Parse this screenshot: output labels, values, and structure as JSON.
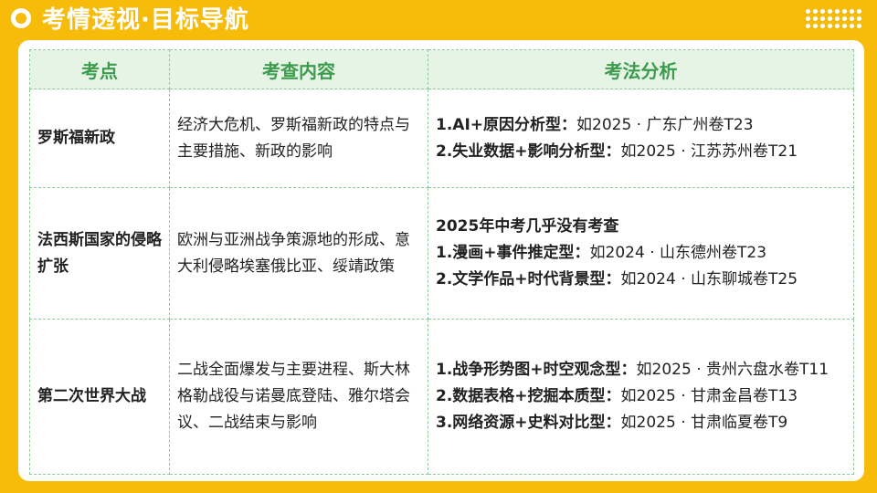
{
  "title": "考情透视·目标导航",
  "colors": {
    "background": "#F7BC0A",
    "header_fill": "#E6F4E6",
    "header_text": "#3C9B4C",
    "border": "#8FC89A"
  },
  "table": {
    "headers": [
      "考点",
      "考查内容",
      "考法分析"
    ],
    "rows": [
      {
        "point": "罗斯福新政",
        "content": "经济大危机、罗斯福新政的特点与主要措施、新政的影响",
        "analysis": [
          {
            "bold": "1.AI+原因分析型：",
            "text": "如2025 · 广东广州卷T23"
          },
          {
            "bold": "2.失业数据+影响分析型：",
            "text": "如2025 · 江苏苏州卷T21"
          }
        ]
      },
      {
        "point": "法西斯国家的侵略扩张",
        "content": "欧洲与亚洲战争策源地的形成、意大利侵略埃塞俄比亚、绥靖政策",
        "analysis": [
          {
            "bold": "2025年中考几乎没有考查",
            "text": ""
          },
          {
            "bold": "1.漫画+事件推定型：",
            "text": "如2024 · 山东德州卷T23"
          },
          {
            "bold": "2.文学作品+时代背景型：",
            "text": "如2024 · 山东聊城卷T25"
          }
        ]
      },
      {
        "point": "第二次世界大战",
        "content": "二战全面爆发与主要进程、斯大林格勒战役与诺曼底登陆、雅尔塔会议、二战结束与影响",
        "analysis": [
          {
            "bold": "1.战争形势图+时空观念型：",
            "text": "如2025 · 贵州六盘水卷T11"
          },
          {
            "bold": "2.数据表格+挖掘本质型：",
            "text": "如2025 · 甘肃金昌卷T13"
          },
          {
            "bold": "3.网络资源+史料对比型：",
            "text": "如2025 · 甘肃临夏卷T9"
          }
        ]
      }
    ]
  }
}
